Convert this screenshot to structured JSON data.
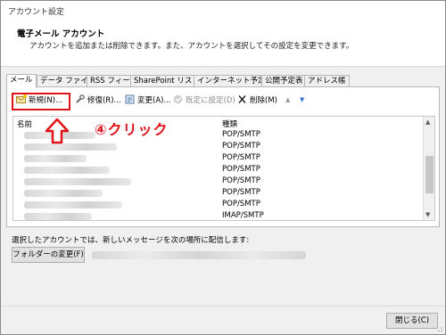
{
  "window": {
    "title": "アカウント設定"
  },
  "header": {
    "title": "電子メール アカウント",
    "description": "アカウントを追加または削除できます。また、アカウントを選択してその設定を変更できます。"
  },
  "tabs": [
    {
      "label": "メール"
    },
    {
      "label": "データ ファイル"
    },
    {
      "label": "RSS フィード"
    },
    {
      "label": "SharePoint リスト"
    },
    {
      "label": "インターネット予定表"
    },
    {
      "label": "公開予定表"
    },
    {
      "label": "アドレス帳"
    }
  ],
  "toolbar": {
    "new_label": "新規(N)...",
    "repair_label": "修復(R)...",
    "change_label": "変更(A)...",
    "set_default_label": "既定に設定(D)",
    "remove_label": "削除(M)",
    "up_arrow": "▲",
    "down_arrow": "▼"
  },
  "list": {
    "header_name": "名前",
    "header_type": "種類",
    "rows": [
      {
        "type": "POP/SMTP"
      },
      {
        "type": "POP/SMTP"
      },
      {
        "type": "POP/SMTP"
      },
      {
        "type": "POP/SMTP"
      },
      {
        "type": "POP/SMTP"
      },
      {
        "type": "POP/SMTP"
      },
      {
        "type": "POP/SMTP"
      },
      {
        "type": "IMAP/SMTP"
      }
    ]
  },
  "annotation": {
    "text": "④クリック",
    "color": "#e0121a"
  },
  "delivery": {
    "label": "選択したアカウントでは、新しいメッセージを次の場所に配信します:",
    "change_folder_label": "フォルダーの変更(F)"
  },
  "footer": {
    "close_label": "閉じる(C)"
  },
  "icons": {
    "new": "new-mail-icon",
    "repair": "repair-icon",
    "change": "change-icon",
    "set_default": "check-circle-icon",
    "remove": "x-delete-icon"
  }
}
